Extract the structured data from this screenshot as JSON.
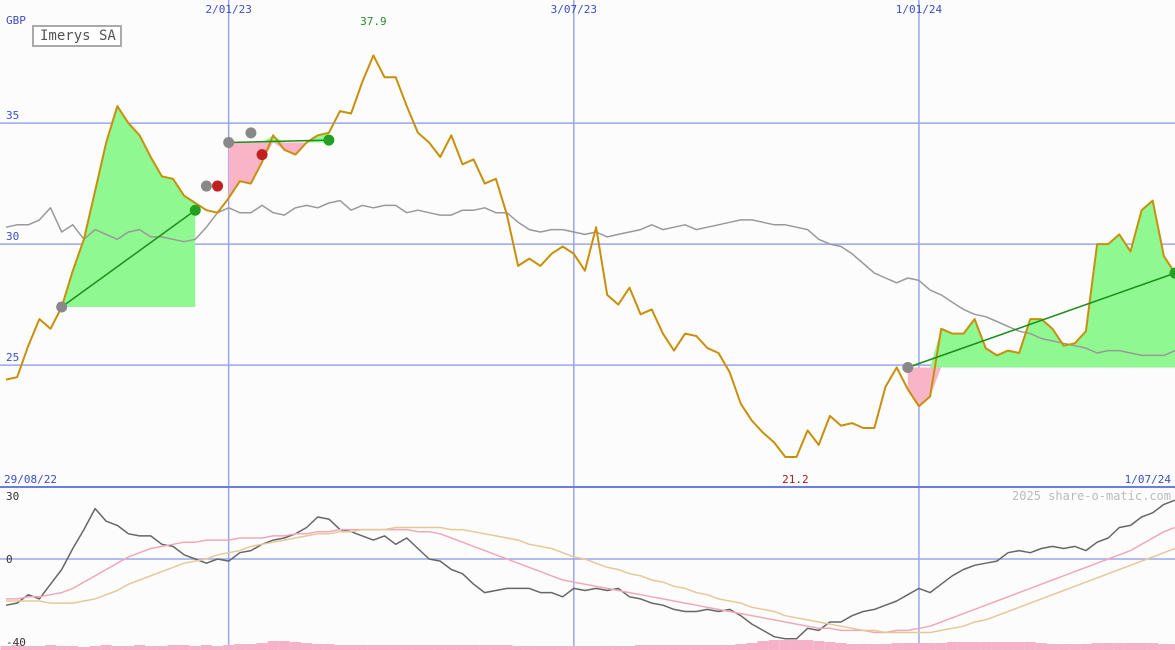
{
  "chart_data": {
    "type": "line",
    "title": "Imerys SA",
    "currency": "GBP",
    "credit": "2025 share-o-matic.com",
    "date_range": {
      "start": "29/08/22",
      "end": "1/07/24"
    },
    "x_ticks": [
      "2/01/23",
      "3/07/23",
      "1/01/24"
    ],
    "price_panel": {
      "ylim": [
        21.2,
        37.9
      ],
      "y_ticks": [
        "35",
        "30",
        "25"
      ],
      "max_label": "37.9",
      "min_label": "21.2",
      "series": [
        {
          "name": "",
          "role": "price",
          "color": "#c8900a",
          "values": [
            24.4,
            24.5,
            25.8,
            26.9,
            26.5,
            27.4,
            28.9,
            30.2,
            32.2,
            34.2,
            35.7,
            35.0,
            34.5,
            33.6,
            32.8,
            32.7,
            32.0,
            31.7,
            31.4,
            31.3,
            31.9,
            32.6,
            32.5,
            33.4,
            34.5,
            33.9,
            33.7,
            34.2,
            34.5,
            34.6,
            35.5,
            35.4,
            36.7,
            37.8,
            36.9,
            36.9,
            35.7,
            34.6,
            34.2,
            33.6,
            34.5,
            33.3,
            33.5,
            32.5,
            32.7,
            31.2,
            29.1,
            29.4,
            29.1,
            29.6,
            29.9,
            29.6,
            28.9,
            30.7,
            27.9,
            27.5,
            28.2,
            27.1,
            27.3,
            26.3,
            25.6,
            26.3,
            26.2,
            25.7,
            25.5,
            24.7,
            23.4,
            22.7,
            22.2,
            21.8,
            21.2,
            21.2,
            22.3,
            21.7,
            22.9,
            22.5,
            22.6,
            22.4,
            22.4,
            24.1,
            24.9,
            24.0,
            23.3,
            23.7,
            26.5,
            26.3,
            26.3,
            26.9,
            25.7,
            25.4,
            25.6,
            25.5,
            26.9,
            26.9,
            26.5,
            25.8,
            25.9,
            26.4,
            30.0,
            30.0,
            30.4,
            29.7,
            31.4,
            31.8,
            29.5,
            28.8
          ]
        },
        {
          "name": "",
          "role": "relative-index",
          "color": "#999999",
          "values": [
            30.7,
            30.8,
            30.8,
            31.0,
            31.5,
            30.5,
            30.8,
            30.2,
            30.6,
            30.4,
            30.2,
            30.5,
            30.6,
            30.3,
            30.3,
            30.2,
            30.1,
            30.2,
            30.7,
            31.3,
            31.5,
            31.3,
            31.3,
            31.6,
            31.3,
            31.2,
            31.5,
            31.6,
            31.5,
            31.7,
            31.8,
            31.4,
            31.6,
            31.5,
            31.6,
            31.6,
            31.3,
            31.4,
            31.3,
            31.2,
            31.2,
            31.4,
            31.4,
            31.5,
            31.3,
            31.3,
            30.9,
            30.6,
            30.5,
            30.6,
            30.6,
            30.5,
            30.4,
            30.5,
            30.3,
            30.4,
            30.5,
            30.6,
            30.8,
            30.6,
            30.7,
            30.8,
            30.6,
            30.7,
            30.8,
            30.9,
            31.0,
            31.0,
            30.9,
            30.8,
            30.8,
            30.7,
            30.6,
            30.2,
            30.0,
            29.9,
            29.6,
            29.2,
            28.8,
            28.6,
            28.4,
            28.6,
            28.5,
            28.1,
            27.9,
            27.6,
            27.3,
            27.1,
            27.0,
            26.8,
            26.6,
            26.4,
            26.3,
            26.1,
            26.0,
            25.9,
            25.8,
            25.7,
            25.5,
            25.6,
            25.6,
            25.5,
            25.4,
            25.4,
            25.4,
            25.6
          ]
        }
      ],
      "trend_lines": [
        {
          "from": {
            "i": 5,
            "v": 27.4
          },
          "to": {
            "i": 17,
            "v": 31.4
          }
        },
        {
          "from": {
            "i": 20,
            "v": 34.2
          },
          "to": {
            "i": 29,
            "v": 34.3
          }
        },
        {
          "from": {
            "i": 81,
            "v": 24.9
          },
          "to": {
            "i": 105,
            "v": 28.8
          }
        }
      ]
    },
    "oscillator_panel": {
      "ylim": [
        -40,
        30
      ],
      "y_ticks": [
        "30",
        "0",
        "-40"
      ],
      "series": [
        {
          "name": "",
          "role": "momentum",
          "color": "#666666",
          "values": [
            -22,
            -21,
            -17,
            -19,
            -12,
            -5,
            5,
            14,
            24,
            18,
            16,
            12,
            11,
            11,
            7,
            6,
            2,
            0,
            -2,
            0,
            -1,
            3,
            4,
            7,
            9,
            10,
            12,
            15,
            20,
            19,
            14,
            13,
            11,
            9,
            11,
            7,
            10,
            5,
            0,
            -1,
            -5,
            -7,
            -12,
            -16,
            -15,
            -14,
            -14,
            -14,
            -16,
            -16,
            -18,
            -14,
            -15,
            -14,
            -15,
            -14,
            -18,
            -19,
            -21,
            -22,
            -24,
            -25,
            -25,
            -24,
            -25,
            -24,
            -27,
            -31,
            -34,
            -37,
            -38,
            -38,
            -33,
            -34,
            -30,
            -30,
            -27,
            -25,
            -24,
            -22,
            -20,
            -17,
            -14,
            -16,
            -12,
            -8,
            -5,
            -3,
            -2,
            -1,
            3,
            4,
            3,
            5,
            6,
            5,
            6,
            4,
            8,
            10,
            15,
            16,
            20,
            22,
            26,
            28
          ]
        },
        {
          "name": "",
          "role": "signal-fast",
          "color": "#f0a8b8",
          "values": [
            -19,
            -19,
            -18,
            -18,
            -17,
            -16,
            -14,
            -11,
            -8,
            -5,
            -2,
            1,
            3,
            5,
            6,
            7,
            8,
            8,
            9,
            9,
            9,
            10,
            10,
            10,
            11,
            11,
            12,
            12,
            13,
            13,
            14,
            14,
            14,
            14,
            14,
            14,
            14,
            13,
            13,
            12,
            10,
            8,
            6,
            4,
            2,
            0,
            -2,
            -4,
            -6,
            -8,
            -10,
            -11,
            -12,
            -13,
            -14,
            -15,
            -16,
            -17,
            -18,
            -19,
            -20,
            -21,
            -22,
            -23,
            -24,
            -25,
            -26,
            -27,
            -28,
            -29,
            -30,
            -31,
            -32,
            -33,
            -33,
            -34,
            -34,
            -34,
            -35,
            -35,
            -34,
            -34,
            -33,
            -32,
            -30,
            -28,
            -26,
            -24,
            -22,
            -20,
            -18,
            -16,
            -14,
            -12,
            -10,
            -8,
            -6,
            -4,
            -2,
            0,
            2,
            4,
            7,
            10,
            13,
            15
          ]
        },
        {
          "name": "",
          "role": "signal-slow",
          "color": "#e6c898",
          "values": [
            -20,
            -20,
            -20,
            -20,
            -21,
            -21,
            -21,
            -20,
            -19,
            -17,
            -15,
            -12,
            -10,
            -8,
            -6,
            -4,
            -2,
            -1,
            0,
            2,
            3,
            4,
            6,
            7,
            8,
            9,
            10,
            11,
            12,
            12,
            13,
            13,
            14,
            14,
            14,
            15,
            15,
            15,
            15,
            15,
            14,
            14,
            13,
            12,
            11,
            10,
            9,
            7,
            6,
            5,
            3,
            1,
            0,
            -2,
            -4,
            -5,
            -7,
            -8,
            -10,
            -11,
            -13,
            -14,
            -16,
            -17,
            -19,
            -20,
            -21,
            -23,
            -24,
            -25,
            -27,
            -28,
            -29,
            -30,
            -31,
            -32,
            -33,
            -34,
            -34,
            -35,
            -35,
            -35,
            -35,
            -35,
            -34,
            -33,
            -32,
            -30,
            -29,
            -27,
            -25,
            -23,
            -21,
            -19,
            -17,
            -15,
            -13,
            -11,
            -9,
            -7,
            -5,
            -3,
            -1,
            1,
            3,
            5
          ]
        }
      ],
      "volume": [
        4,
        5,
        4,
        4,
        5,
        4,
        4,
        3,
        4,
        5,
        4,
        4,
        5,
        4,
        4,
        5,
        5,
        4,
        5,
        4,
        5,
        6,
        6,
        7,
        9,
        9,
        8,
        7,
        6,
        6,
        5,
        5,
        5,
        5,
        5,
        5,
        5,
        5,
        5,
        5,
        5,
        5,
        5,
        5,
        5,
        5,
        4,
        4,
        4,
        4,
        4,
        4,
        4,
        4,
        4,
        4,
        4,
        5,
        5,
        5,
        5,
        5,
        5,
        5,
        5,
        5,
        6,
        7,
        9,
        10,
        10,
        10,
        10,
        9,
        8,
        7,
        6,
        6,
        6,
        6,
        7,
        7,
        7,
        7,
        7,
        8,
        8,
        8,
        8,
        8,
        8,
        8,
        8,
        7,
        6,
        6,
        6,
        6,
        7,
        7,
        7,
        7,
        7,
        7,
        6,
        6
      ]
    }
  }
}
